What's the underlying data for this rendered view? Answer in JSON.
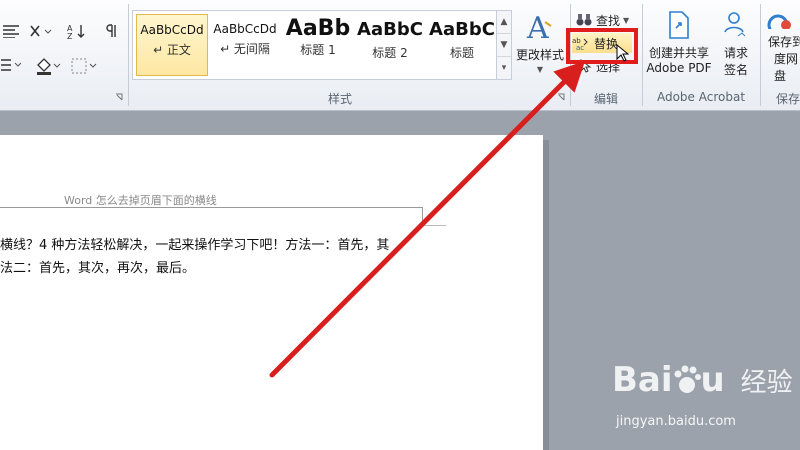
{
  "ribbon": {
    "styles": {
      "group_label": "样式",
      "tiles": [
        {
          "sample": "AaBbCcDd",
          "name": "↵ 正文"
        },
        {
          "sample": "AaBbCcDd",
          "name": "↵ 无间隔"
        },
        {
          "sample": "AaBb",
          "name": "标题 1"
        },
        {
          "sample": "AaBbC",
          "name": "标题 2"
        },
        {
          "sample": "AaBbC",
          "name": "标题"
        }
      ],
      "change_styles_label": "更改样式"
    },
    "editing": {
      "group_label": "编辑",
      "find_label": "查找",
      "replace_label": "替换",
      "select_label": "选择"
    },
    "acrobat": {
      "group_label": "Adobe Acrobat",
      "create_share_line1": "创建并共享",
      "create_share_line2": "Adobe PDF",
      "request_sign_line1": "请求",
      "request_sign_line2": "签名"
    },
    "save": {
      "group_label": "保存",
      "save_line1": "保存到",
      "save_line2": "度网盘"
    }
  },
  "document": {
    "header": "Word 怎么去掉页眉下面的横线",
    "line1": "横线？4 种方法轻松解决，一起来操作学习下吧！方法一：首先，其",
    "line2": "法二：首先，其次，再次，最后。"
  },
  "watermark": {
    "brand_left": "Bai",
    "brand_right": "u",
    "brand_cn": "经验",
    "url": "jingyan.baidu.com"
  },
  "colors": {
    "highlight": "#e21c1c",
    "selected_tile": "#fde7a3"
  }
}
